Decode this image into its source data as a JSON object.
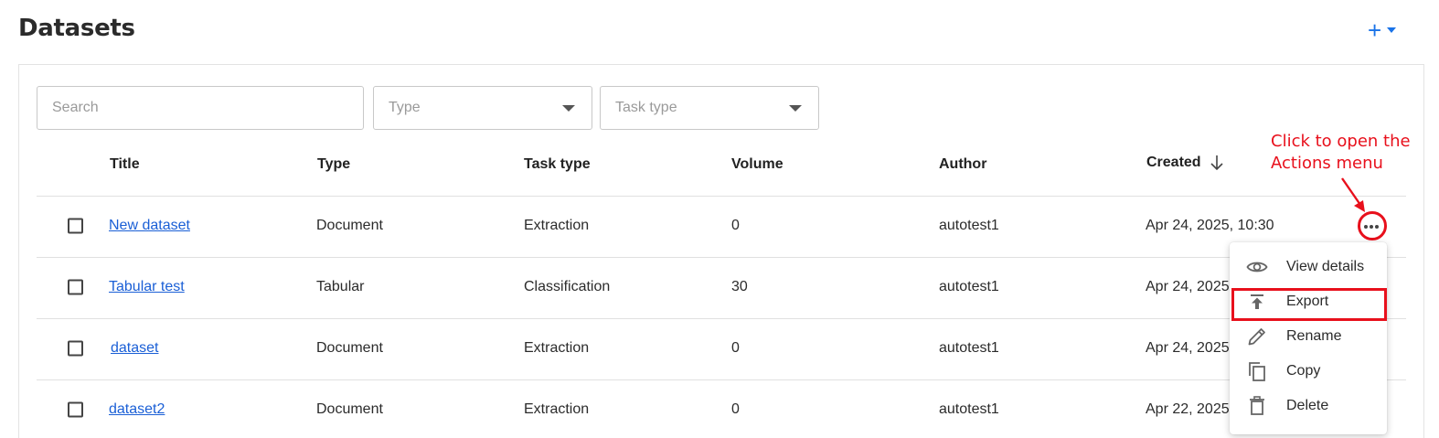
{
  "page": {
    "title": "Datasets",
    "add_label": "+"
  },
  "filters": {
    "search_placeholder": "Search",
    "type_placeholder": "Type",
    "task_type_placeholder": "Task type"
  },
  "table": {
    "columns": [
      "Title",
      "Type",
      "Task type",
      "Volume",
      "Author",
      "Created"
    ],
    "sort": {
      "column": "Created",
      "direction": "descending"
    },
    "rows": [
      {
        "title": "New dataset",
        "type": "Document",
        "task_type": "Extraction",
        "volume": "0",
        "author": "autotest1",
        "created": "Apr 24, 2025, 10:30"
      },
      {
        "title": "Tabular test",
        "type": "Tabular",
        "task_type": "Classification",
        "volume": "30",
        "author": "autotest1",
        "created": "Apr 24, 2025"
      },
      {
        "title": "dataset",
        "type": "Document",
        "task_type": "Extraction",
        "volume": "0",
        "author": "autotest1",
        "created": "Apr 24, 2025"
      },
      {
        "title": "dataset2",
        "type": "Document",
        "task_type": "Extraction",
        "volume": "0",
        "author": "autotest1",
        "created": "Apr 22, 2025"
      }
    ]
  },
  "actions_menu": {
    "items": [
      {
        "label": "View details",
        "icon": "eye-icon"
      },
      {
        "label": "Export",
        "icon": "export-icon"
      },
      {
        "label": "Rename",
        "icon": "pencil-icon"
      },
      {
        "label": "Copy",
        "icon": "copy-icon"
      },
      {
        "label": "Delete",
        "icon": "trash-icon"
      }
    ]
  },
  "annotation": {
    "line1": "Click to open the",
    "line2": "Actions menu",
    "color": "#e8101c"
  },
  "colors": {
    "accent": "#1a73e8",
    "link": "#1a5fd6",
    "highlight": "#e8101c"
  }
}
